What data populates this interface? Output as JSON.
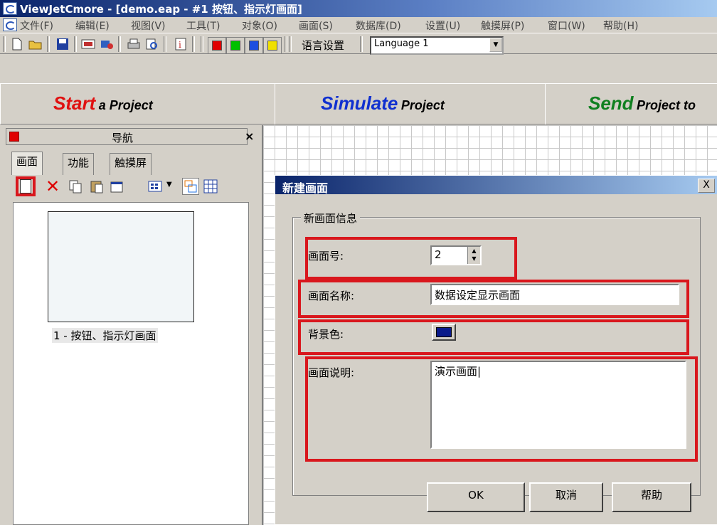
{
  "window": {
    "title": "ViewJetCmore - [demo.eap - #1 按钮、指示灯画面]"
  },
  "menu": [
    "文件(F)",
    "编辑(E)",
    "视图(V)",
    "工具(T)",
    "对象(O)",
    "画面(S)",
    "数据库(D)",
    "设置(U)",
    "触摸屏(P)",
    "窗口(W)",
    "帮助(H)"
  ],
  "toolbar": {
    "color_swatches": [
      "#e00000",
      "#00c000",
      "#1e4fe0",
      "#f0e000"
    ],
    "language_label": "语言设置",
    "language_value": "Language 1"
  },
  "banner": {
    "start_big": "Start",
    "start_small": "a Project",
    "simulate_big": "Simulate",
    "simulate_small": "Project",
    "send_big": "Send",
    "send_small": "Project to"
  },
  "nav": {
    "title": "导航",
    "close": "×",
    "tabs": [
      "画面",
      "功能",
      "触摸屏"
    ],
    "screen_item": "1 - 按钮、指示灯画面"
  },
  "dialog": {
    "title": "新建画面",
    "close": "X",
    "group_label": "新画面信息",
    "screen_no_label": "画面号:",
    "screen_no_value": "2",
    "screen_name_label": "画面名称:",
    "screen_name_value": "数据设定显示画面",
    "bg_label": "背景色:",
    "bg_color": "#0a1a8a",
    "desc_label": "画面说明:",
    "desc_value": "演示画面|",
    "ok": "OK",
    "cancel": "取消",
    "help": "帮助"
  }
}
